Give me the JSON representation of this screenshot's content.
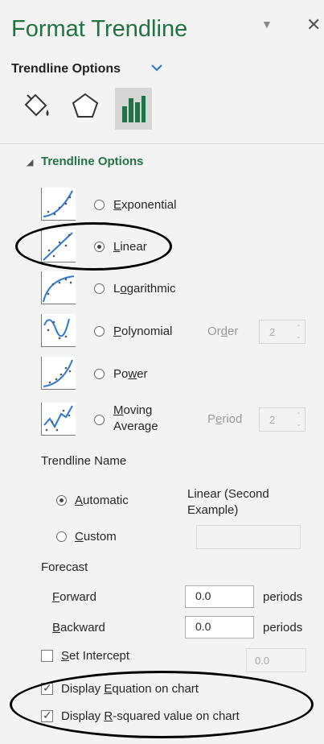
{
  "header": {
    "title": "Format Trendline",
    "dropdown_icon": "chevron-down-icon",
    "close_label": "✕"
  },
  "subheader": {
    "label": "Trendline Options"
  },
  "tabs": [
    {
      "name": "Fill & Line",
      "icon": "paint-bucket-icon"
    },
    {
      "name": "Effects",
      "icon": "pentagon-icon"
    },
    {
      "name": "Trendline Options",
      "icon": "bar-chart-icon",
      "selected": true
    }
  ],
  "section": {
    "title": "Trendline Options"
  },
  "types": [
    {
      "pre": "",
      "u": "E",
      "post": "xponential",
      "selected": false
    },
    {
      "pre": "",
      "u": "L",
      "post": "inear",
      "selected": true
    },
    {
      "pre": "L",
      "u": "o",
      "post": "garithmic",
      "selected": false
    },
    {
      "pre": "",
      "u": "P",
      "post": "olynomial",
      "selected": false
    },
    {
      "pre": "Po",
      "u": "w",
      "post": "er",
      "selected": false
    },
    {
      "pre": "",
      "u": "M",
      "post": "oving",
      "line2": "Average",
      "selected": false
    }
  ],
  "order": {
    "pre": "Or",
    "u": "d",
    "post": "er",
    "value": "2"
  },
  "period": {
    "pre": "P",
    "u": "e",
    "post": "riod",
    "value": "2"
  },
  "trendline_name": {
    "heading": "Trendline Name",
    "automatic": {
      "u": "A",
      "post": "utomatic",
      "selected": true
    },
    "auto_value": "Linear (Second Example)",
    "custom": {
      "u": "C",
      "post": "ustom",
      "selected": false
    },
    "custom_value": ""
  },
  "forecast": {
    "heading": "Forecast",
    "forward": {
      "u": "F",
      "post": "orward",
      "value": "0.0",
      "unit": "periods"
    },
    "backward": {
      "u": "B",
      "post": "ackward",
      "value": "0.0",
      "unit": "periods"
    }
  },
  "intercept": {
    "u": "S",
    "post": "et Intercept",
    "checked": false,
    "value": "0.0"
  },
  "display_equation": {
    "pre": "Display ",
    "u": "E",
    "post": "quation on chart",
    "checked": true
  },
  "display_rsquared": {
    "pre": "Display ",
    "u": "R",
    "post": "-squared value on chart",
    "checked": true
  },
  "colors": {
    "accent": "#217346",
    "link": "#2b78d0",
    "panel_bg": "#f3f3f3"
  }
}
